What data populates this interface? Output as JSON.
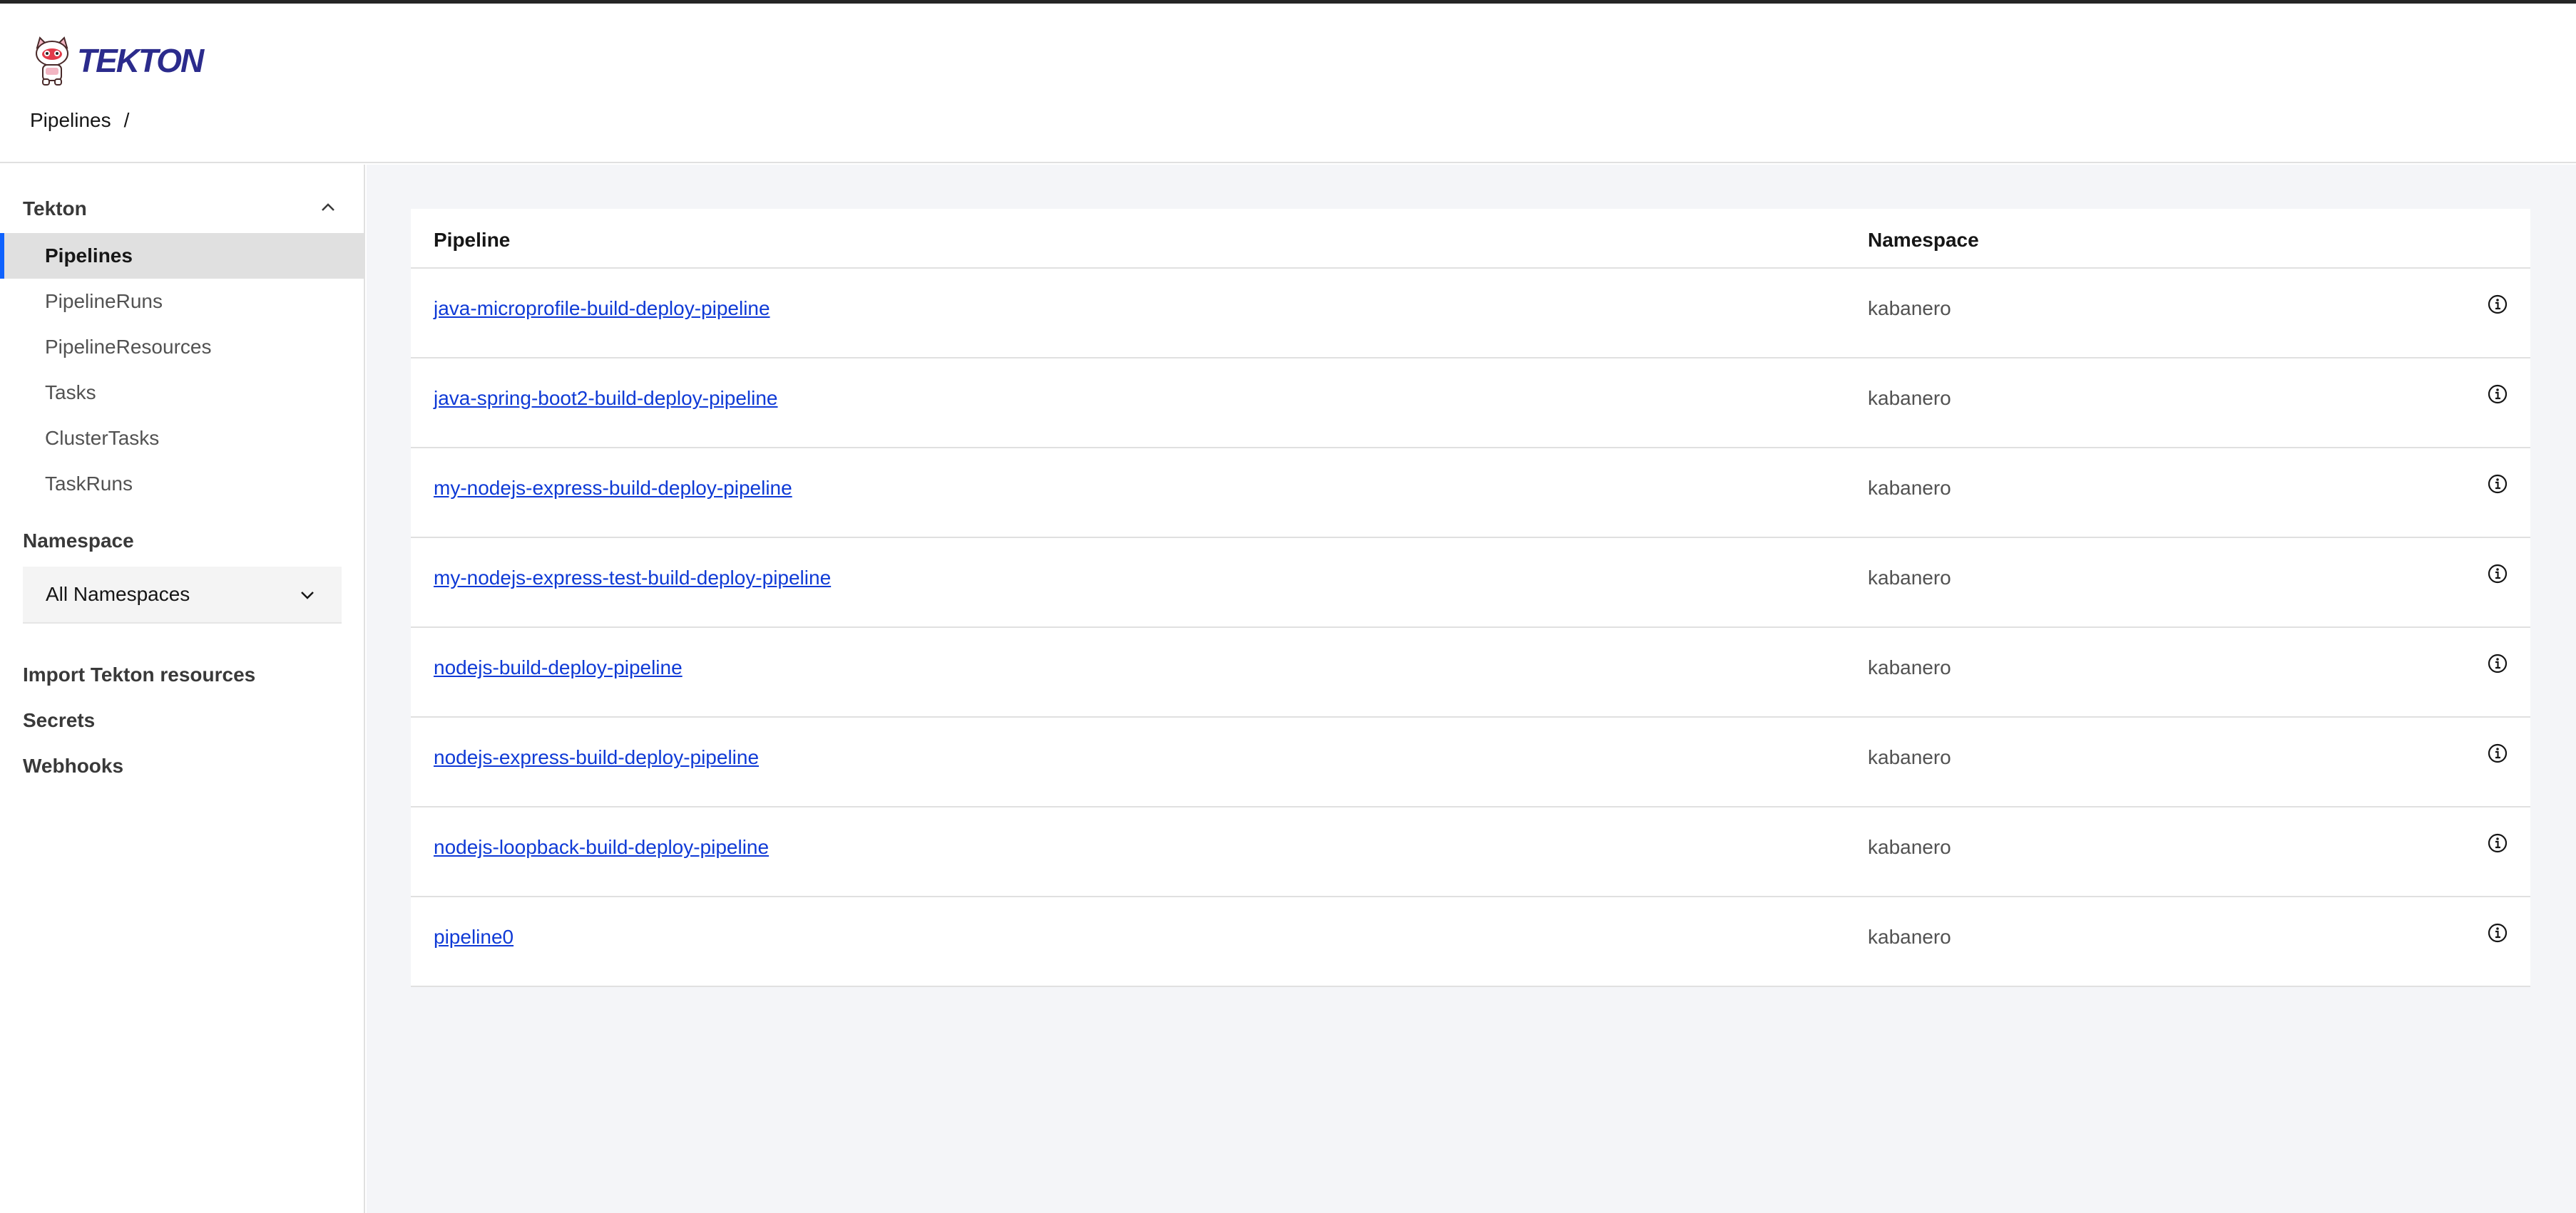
{
  "header": {
    "logo_text": "TEKTON",
    "breadcrumb": {
      "item": "Pipelines",
      "separator": "/"
    }
  },
  "sidebar": {
    "section_title": "Tekton",
    "items": [
      {
        "label": "Pipelines",
        "active": true
      },
      {
        "label": "PipelineRuns",
        "active": false
      },
      {
        "label": "PipelineResources",
        "active": false
      },
      {
        "label": "Tasks",
        "active": false
      },
      {
        "label": "ClusterTasks",
        "active": false
      },
      {
        "label": "TaskRuns",
        "active": false
      }
    ],
    "namespace_title": "Namespace",
    "namespace_selected": "All Namespaces",
    "links": [
      {
        "label": "Import Tekton resources"
      },
      {
        "label": "Secrets"
      },
      {
        "label": "Webhooks"
      }
    ]
  },
  "table": {
    "columns": [
      "Pipeline",
      "Namespace"
    ],
    "rows": [
      {
        "pipeline": "java-microprofile-build-deploy-pipeline",
        "namespace": "kabanero"
      },
      {
        "pipeline": "java-spring-boot2-build-deploy-pipeline",
        "namespace": "kabanero"
      },
      {
        "pipeline": "my-nodejs-express-build-deploy-pipeline",
        "namespace": "kabanero"
      },
      {
        "pipeline": "my-nodejs-express-test-build-deploy-pipeline",
        "namespace": "kabanero"
      },
      {
        "pipeline": "nodejs-build-deploy-pipeline",
        "namespace": "kabanero"
      },
      {
        "pipeline": "nodejs-express-build-deploy-pipeline",
        "namespace": "kabanero"
      },
      {
        "pipeline": "nodejs-loopback-build-deploy-pipeline",
        "namespace": "kabanero"
      },
      {
        "pipeline": "pipeline0",
        "namespace": "kabanero"
      }
    ]
  },
  "colors": {
    "link": "#0f3ad6",
    "active_indicator": "#0f62fe",
    "main_bg": "#f4f5f8"
  }
}
